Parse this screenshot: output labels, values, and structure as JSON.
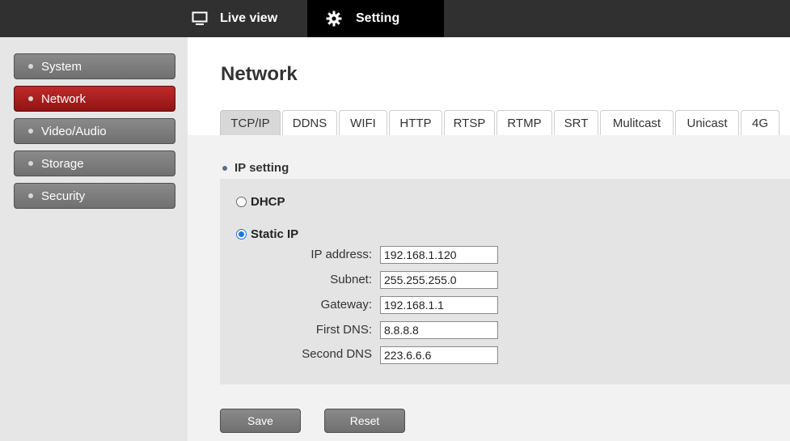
{
  "topnav": {
    "live_view": {
      "label": "Live view",
      "icon": "monitor-icon"
    },
    "setting": {
      "label": "Setting",
      "icon": "gear-icon"
    }
  },
  "sidebar": {
    "items": [
      {
        "label": "System",
        "active": false
      },
      {
        "label": "Network",
        "active": true
      },
      {
        "label": "Video/Audio",
        "active": false
      },
      {
        "label": "Storage",
        "active": false
      },
      {
        "label": "Security",
        "active": false
      }
    ]
  },
  "main": {
    "title": "Network",
    "tabs": [
      "TCP/IP",
      "DDNS",
      "WIFI",
      "HTTP",
      "RTSP",
      "RTMP",
      "SRT",
      "Mulitcast",
      "Unicast",
      "4G"
    ],
    "active_tab": "TCP/IP",
    "section": "IP setting",
    "dhcp_label": "DHCP",
    "static_label": "Static IP",
    "selected_mode": "Static IP",
    "fields": {
      "ip_address": {
        "label": "IP address:",
        "value": "192.168.1.120"
      },
      "subnet": {
        "label": "Subnet:",
        "value": "255.255.255.0"
      },
      "gateway": {
        "label": "Gateway:",
        "value": "192.168.1.1"
      },
      "first_dns": {
        "label": "First DNS:",
        "value": "8.8.8.8"
      },
      "second_dns": {
        "label": "Second DNS",
        "value": "223.6.6.6"
      }
    },
    "save_label": "Save",
    "reset_label": "Reset"
  },
  "colors": {
    "topbar": "#303030",
    "active_nav": "#000000",
    "sidebar_bg": "#e6e6e6",
    "sidebar_item": "#7a7a7a",
    "sidebar_active": "#a81e1e",
    "radio_accent": "#1a73e8"
  }
}
